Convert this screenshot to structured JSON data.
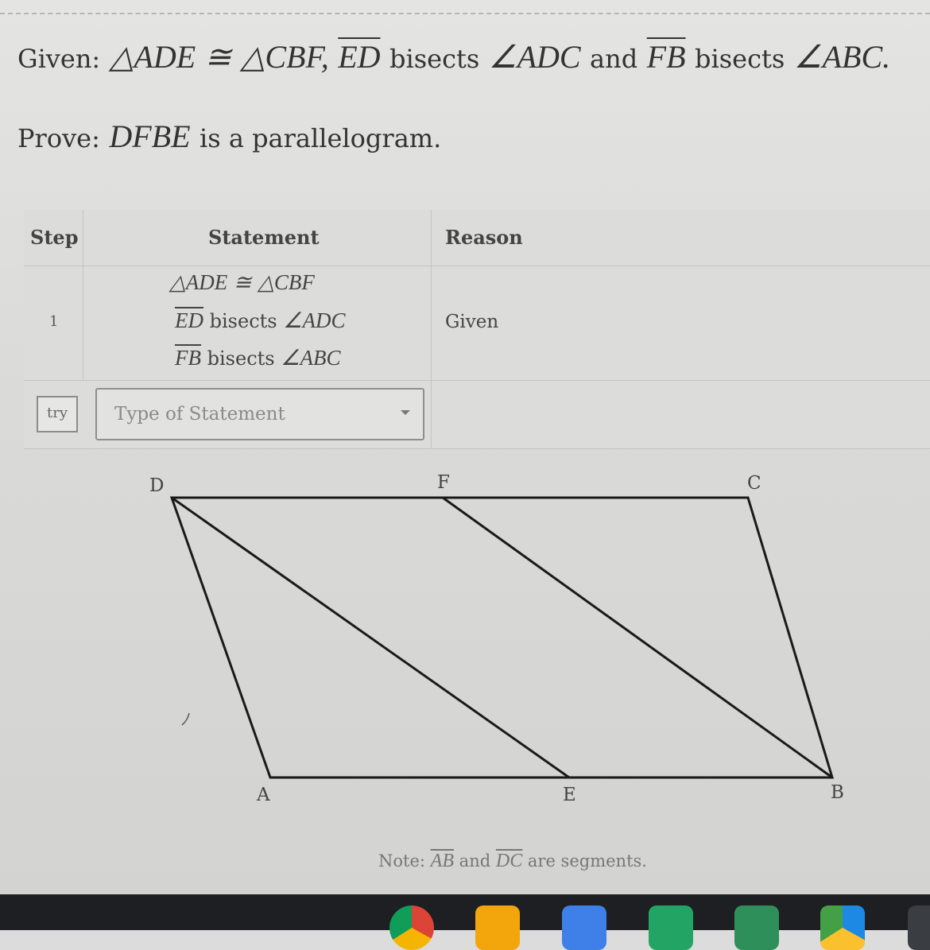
{
  "problem": {
    "given_prefix": "Given:",
    "given_tri1": "△ADE",
    "given_cong": "≅",
    "given_tri2": "△CBF,",
    "given_seg1": "ED",
    "given_bisects1": "bisects",
    "given_angle1": "∠ADC",
    "given_and": "and",
    "given_seg2": "FB",
    "given_bisects2": "bisects",
    "given_angle2": "∠ABC.",
    "prove_prefix": "Prove:",
    "prove_shape": "DFBE",
    "prove_rest": "is a parallelogram."
  },
  "table": {
    "headers": {
      "step": "Step",
      "statement": "Statement",
      "reason": "Reason"
    },
    "rows": [
      {
        "step": "1",
        "statement_line1_a": "△ADE",
        "statement_line1_b": "≅",
        "statement_line1_c": "△CBF",
        "statement_line2_seg": "ED",
        "statement_line2_word": "bisects",
        "statement_line2_angle": "∠ADC",
        "statement_line3_seg": "FB",
        "statement_line3_word": "bisects",
        "statement_line3_angle": "∠ABC",
        "reason": "Given"
      }
    ],
    "try_label": "try",
    "statement_select_placeholder": "Type of Statement"
  },
  "diagram": {
    "labels": {
      "D": "D",
      "F": "F",
      "C": "C",
      "A": "A",
      "E": "E",
      "B": "B"
    },
    "stroke_color": "#1a1a1a"
  },
  "note": {
    "prefix": "Note:",
    "seg1": "AB",
    "and": "and",
    "seg2": "DC",
    "suffix": "are segments."
  }
}
